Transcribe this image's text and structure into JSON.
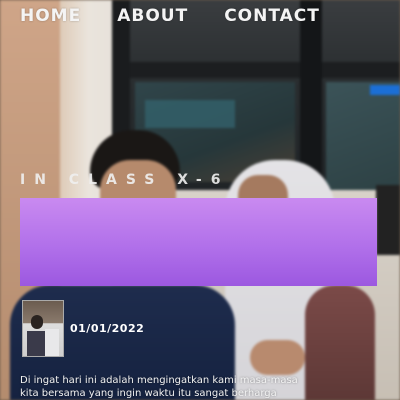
{
  "nav": {
    "items": [
      {
        "label": "HOME"
      },
      {
        "label": "ABOUT"
      },
      {
        "label": "CONTACT"
      }
    ]
  },
  "hero": {
    "class_label": "IN CLASS X-6"
  },
  "banner": {
    "color": "#b170ea"
  },
  "post": {
    "date": "01/01/2022",
    "description_line1": "Di ingat hari ini adalah mengingatkan kami masa-masa",
    "description_line2": "kita bersama yang ingin waktu itu sangat berharga"
  }
}
